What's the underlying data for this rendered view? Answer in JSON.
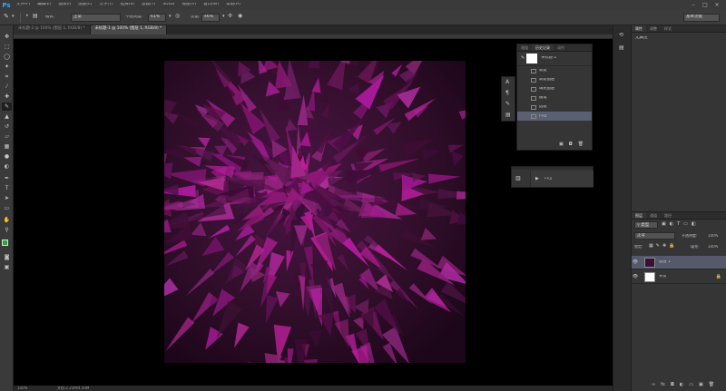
{
  "app": {
    "logo": "Ps"
  },
  "menu": [
    "文件(F)",
    "编辑(E)",
    "图像(I)",
    "图层(L)",
    "文字(Y)",
    "选择(S)",
    "滤镜(T)",
    "3D(D)",
    "视图(V)",
    "窗口(W)",
    "帮助(H)"
  ],
  "window_controls": [
    "–",
    "□",
    "×"
  ],
  "options": {
    "mode_label": "模式:",
    "mode_value": "正常",
    "opacity_label": "不透明度:",
    "opacity_value": "61%",
    "flow_label": "流量:",
    "flow_value": "46%",
    "workspace": "基本功能"
  },
  "tabs": [
    {
      "label": "未标题-2 @ 100% (图层 1, RGB/8) *",
      "active": false
    },
    {
      "label": "未标题-1 @ 100% (图层 1, RGB/8) *",
      "active": true
    }
  ],
  "history_panel": {
    "tabs": [
      "通道",
      "历史记录",
      "动作"
    ],
    "snapshot": "未标题-2",
    "items": [
      "新建",
      "新建图层",
      "填充图层",
      "画笔",
      "选框",
      "凸出"
    ],
    "selected": 5
  },
  "actions_panel": {
    "item": "凸出"
  },
  "properties_panel": {
    "tabs": [
      "属性",
      "调整",
      "样式"
    ],
    "content": "无属性"
  },
  "layers_panel": {
    "tabs": [
      "图层",
      "通道",
      "路径"
    ],
    "kind_label": "类型",
    "blend": "正常",
    "opacity_label": "不透明度:",
    "opacity_value": "100%",
    "lock_label": "锁定:",
    "fill_label": "填充:",
    "fill_value": "100%",
    "layers": [
      {
        "name": "图层 1",
        "selected": true
      },
      {
        "name": "背景",
        "selected": false
      }
    ]
  },
  "status": {
    "zoom": "100%",
    "doc": "文档:2.25M/4.50M"
  },
  "colors": {
    "foreground": "#2fa33a",
    "background": "#ffffff",
    "accent": "#5a6071",
    "artwork": "#6e1c66"
  },
  "icons": [
    "brush-icon",
    "move-icon",
    "marquee-icon",
    "lasso-icon",
    "wand-icon",
    "crop-icon",
    "eyedropper-icon",
    "healing-icon",
    "brush-tool-icon",
    "stamp-icon",
    "history-brush-icon",
    "eraser-icon",
    "gradient-icon",
    "blur-icon",
    "dodge-icon",
    "pen-icon",
    "type-icon",
    "path-select-icon",
    "shape-icon",
    "hand-icon",
    "zoom-icon",
    "eye-icon"
  ]
}
